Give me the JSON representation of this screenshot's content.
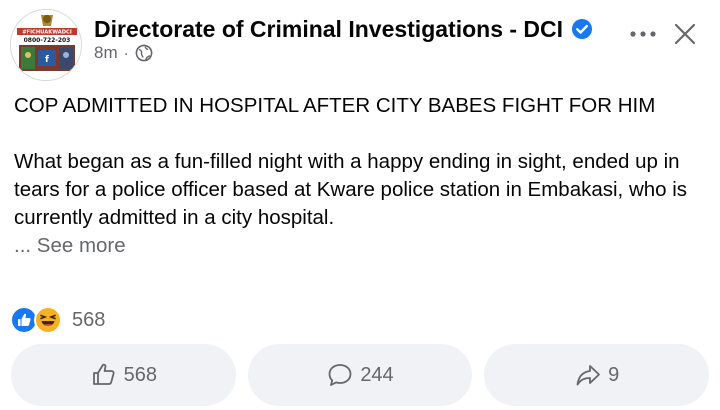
{
  "post": {
    "page_name": "Directorate of Criminal Investigations - DCI",
    "time_ago": "8m",
    "meta_separator": "·",
    "headline": "COP ADMITTED IN HOSPITAL AFTER CITY BABES FIGHT FOR HIM",
    "body": "What began as a fun-filled night with a happy ending in sight, ended up in tears for a police officer based at Kware police station in Embakasi, who is currently admitted in a city hospital.",
    "see_more": "... See more",
    "avatar_text": {
      "hashtag": "#FICHUAKWADCI",
      "phone": "0800-722-203"
    }
  },
  "reactions": {
    "count": "568",
    "types": [
      "like-icon",
      "haha-icon"
    ]
  },
  "actions": {
    "like_count": "568",
    "comment_count": "244",
    "share_count": "9"
  },
  "colors": {
    "accent": "#1877f2",
    "secondary_text": "#65676b",
    "button_bg": "#f0f2f5",
    "haha_yellow": "#f7b125"
  }
}
